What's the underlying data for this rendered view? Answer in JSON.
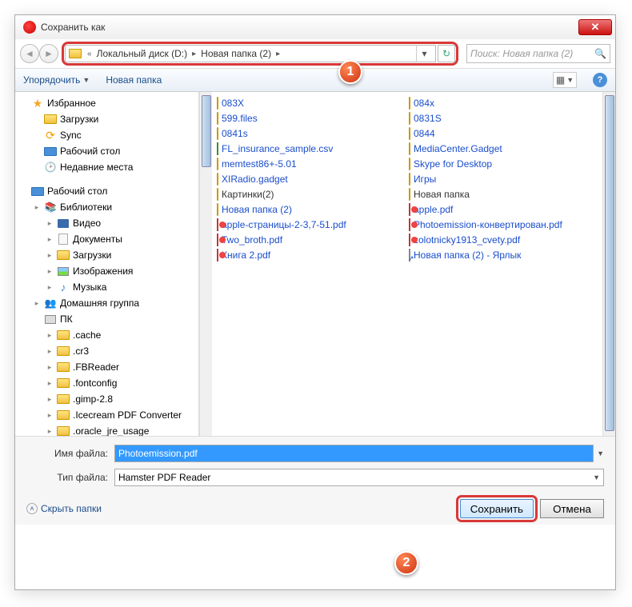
{
  "titlebar": {
    "title": "Сохранить как",
    "close": "✕"
  },
  "breadcrumb": {
    "chevrons": "«",
    "seg1": "Локальный диск (D:)",
    "seg2": "Новая папка (2)"
  },
  "search": {
    "placeholder": "Поиск: Новая папка (2)"
  },
  "toolbar": {
    "organize": "Упорядочить",
    "newfolder": "Новая папка"
  },
  "tree": [
    {
      "indent": 0,
      "exp": "",
      "icon": "star",
      "label": "Избранное"
    },
    {
      "indent": 1,
      "exp": "",
      "icon": "folder",
      "label": "Загрузки"
    },
    {
      "indent": 1,
      "exp": "",
      "icon": "sync",
      "label": "Sync"
    },
    {
      "indent": 1,
      "exp": "",
      "icon": "desktop",
      "label": "Рабочий стол"
    },
    {
      "indent": 1,
      "exp": "",
      "icon": "recent",
      "label": "Недавние места"
    },
    {
      "indent": 0,
      "exp": "",
      "icon": "blank",
      "label": ""
    },
    {
      "indent": 0,
      "exp": "",
      "icon": "desktop",
      "label": "Рабочий стол"
    },
    {
      "indent": 1,
      "exp": "▸",
      "icon": "lib",
      "label": "Библиотеки"
    },
    {
      "indent": 2,
      "exp": "▸",
      "icon": "video",
      "label": "Видео"
    },
    {
      "indent": 2,
      "exp": "▸",
      "icon": "doc",
      "label": "Документы"
    },
    {
      "indent": 2,
      "exp": "▸",
      "icon": "folder",
      "label": "Загрузки"
    },
    {
      "indent": 2,
      "exp": "▸",
      "icon": "img",
      "label": "Изображения"
    },
    {
      "indent": 2,
      "exp": "▸",
      "icon": "music",
      "label": "Музыка"
    },
    {
      "indent": 1,
      "exp": "▸",
      "icon": "home",
      "label": "Домашняя группа"
    },
    {
      "indent": 1,
      "exp": "",
      "icon": "pc",
      "label": "ПК"
    },
    {
      "indent": 2,
      "exp": "▸",
      "icon": "folder",
      "label": ".cache"
    },
    {
      "indent": 2,
      "exp": "▸",
      "icon": "folder",
      "label": ".cr3"
    },
    {
      "indent": 2,
      "exp": "▸",
      "icon": "folder",
      "label": ".FBReader"
    },
    {
      "indent": 2,
      "exp": "▸",
      "icon": "folder",
      "label": ".fontconfig"
    },
    {
      "indent": 2,
      "exp": "▸",
      "icon": "folder",
      "label": ".gimp-2.8"
    },
    {
      "indent": 2,
      "exp": "▸",
      "icon": "folder",
      "label": ".Icecream PDF Converter"
    },
    {
      "indent": 2,
      "exp": "▸",
      "icon": "folder",
      "label": ".oracle_jre_usage"
    }
  ],
  "files_left": [
    {
      "icon": "folder",
      "name": "083X",
      "link": true
    },
    {
      "icon": "folder",
      "name": "599.files",
      "link": true
    },
    {
      "icon": "folder",
      "name": "0841s",
      "link": true
    },
    {
      "icon": "csv",
      "name": "FL_insurance_sample.csv",
      "link": true
    },
    {
      "icon": "folder",
      "name": "memtest86+-5.01",
      "link": true
    },
    {
      "icon": "folder",
      "name": "XIRadio.gadget",
      "link": true
    },
    {
      "icon": "folder",
      "name": "Картинки(2)",
      "link": false
    },
    {
      "icon": "folder",
      "name": "Новая папка (2)",
      "link": true
    },
    {
      "icon": "pdf",
      "name": "apple-страницы-2-3,7-51.pdf",
      "link": true
    },
    {
      "icon": "pdf",
      "name": "Two_broth.pdf",
      "link": true
    },
    {
      "icon": "pdf",
      "name": "Книга 2.pdf",
      "link": true
    }
  ],
  "files_right": [
    {
      "icon": "folder",
      "name": "084x",
      "link": true
    },
    {
      "icon": "folder",
      "name": "0831S",
      "link": true
    },
    {
      "icon": "folder",
      "name": "0844",
      "link": true
    },
    {
      "icon": "folder",
      "name": "MediaCenter.Gadget",
      "link": true
    },
    {
      "icon": "folder",
      "name": "Skype for Desktop",
      "link": true
    },
    {
      "icon": "folder",
      "name": "Игры",
      "link": true
    },
    {
      "icon": "folder",
      "name": "Новая папка",
      "link": false
    },
    {
      "icon": "pdf",
      "name": "apple.pdf",
      "link": true
    },
    {
      "icon": "pdf",
      "name": "Photoemission-конвертирован.pdf",
      "link": true
    },
    {
      "icon": "pdf",
      "name": "zolotnicky1913_cvety.pdf",
      "link": true
    },
    {
      "icon": "link",
      "name": "Новая папка (2) - Ярлык",
      "link": true
    }
  ],
  "form": {
    "filename_label": "Имя файла:",
    "filename_value": "Photoemission.pdf",
    "filetype_label": "Тип файла:",
    "filetype_value": "Hamster PDF Reader"
  },
  "buttons": {
    "hide": "Скрыть папки",
    "save": "Сохранить",
    "cancel": "Отмена"
  },
  "callouts": {
    "c1": "1",
    "c2": "2"
  }
}
